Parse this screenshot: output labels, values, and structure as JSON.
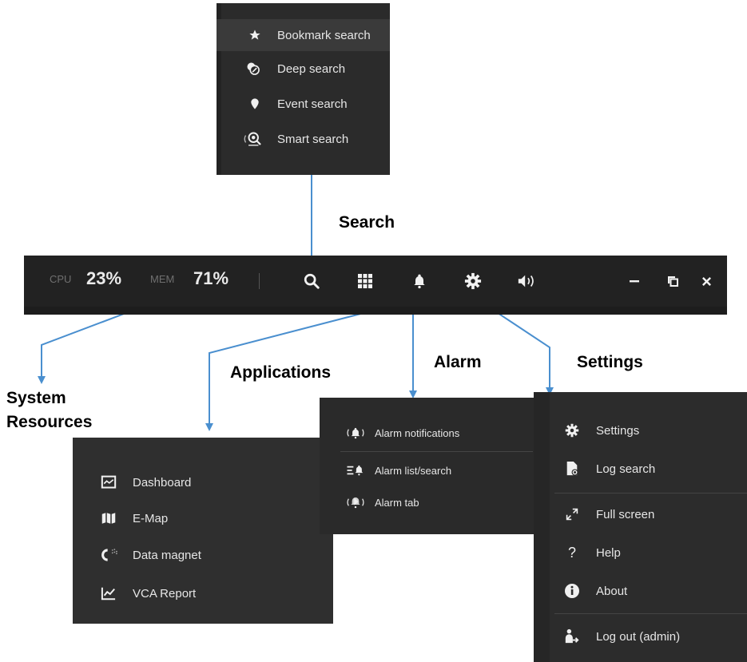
{
  "callouts": {
    "search": "Search",
    "applications": "Applications",
    "alarm": "Alarm",
    "settings": "Settings",
    "system_resources_line1": "System",
    "system_resources_line2": "Resources"
  },
  "toolbar": {
    "cpu_label": "CPU",
    "cpu_value": "23%",
    "mem_label": "MEM",
    "mem_value": "71%",
    "icons": [
      "search-icon",
      "grid-icon",
      "bell-icon",
      "gear-icon",
      "volume-icon",
      "minimize-icon",
      "restore-icon",
      "close-icon"
    ]
  },
  "search_menu": {
    "items": [
      {
        "label": "Bookmark search",
        "icon": "star-icon"
      },
      {
        "label": "Deep search",
        "icon": "deep-search-icon"
      },
      {
        "label": "Event search",
        "icon": "pin-icon"
      },
      {
        "label": "Smart search",
        "icon": "smart-search-icon"
      }
    ]
  },
  "apps_menu": {
    "items": [
      {
        "label": "Dashboard",
        "icon": "dashboard-icon"
      },
      {
        "label": "E-Map",
        "icon": "map-icon"
      },
      {
        "label": "Data magnet",
        "icon": "magnet-icon"
      },
      {
        "label": "VCA Report",
        "icon": "chart-icon"
      }
    ]
  },
  "alarm_menu": {
    "items": [
      {
        "label": "Alarm notifications",
        "icon": "alarm-bell-icon"
      },
      {
        "label": "Alarm list/search",
        "icon": "alarm-list-icon"
      },
      {
        "label": "Alarm tab",
        "icon": "alarm-tab-icon"
      }
    ]
  },
  "settings_menu": {
    "items": [
      {
        "label": "Settings",
        "icon": "gear-icon"
      },
      {
        "label": "Log search",
        "icon": "log-search-icon"
      },
      {
        "label": "Full screen",
        "icon": "fullscreen-icon"
      },
      {
        "label": "Help",
        "icon": "help-icon"
      },
      {
        "label": "About",
        "icon": "info-icon"
      },
      {
        "label": "Log out (admin)",
        "icon": "logout-icon"
      }
    ]
  },
  "colors": {
    "arrow": "#4a8fcf",
    "panel": "#2b2b2b",
    "toolbar": "#222222",
    "text": "#e6e6e6"
  }
}
